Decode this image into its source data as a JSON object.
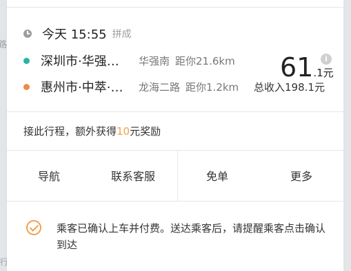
{
  "map": {
    "left_glyph": "路",
    "bottom_glyph": "行"
  },
  "order": {
    "time": "今天 15:55",
    "type_tag": "拼成",
    "pickup": {
      "main": "深圳市·华强…",
      "sub": "华强南",
      "distance": "距你21.6km"
    },
    "dropoff": {
      "main": "惠州市·中萃·…",
      "sub": "龙海二路",
      "distance": "距你1.2km"
    },
    "price_integer": "61",
    "price_decimal": ".1元",
    "total_income": "总收入198.1元",
    "info_icon": "i"
  },
  "reward": {
    "prefix": "接此行程，额外获得",
    "amount": "10",
    "suffix": "元奖励"
  },
  "actions": [
    {
      "label": "导航"
    },
    {
      "label": "联系客服"
    },
    {
      "label": "免单"
    },
    {
      "label": "更多"
    }
  ],
  "notice": {
    "text": "乘客已确认上车并付费。送达乘客后，请提醒乘客点击确认到达"
  },
  "colors": {
    "pickup_dot": "#2bb3a3",
    "dropoff_dot": "#f08a4b",
    "accent": "#f0a04b",
    "clock": "#9e9e9e"
  }
}
